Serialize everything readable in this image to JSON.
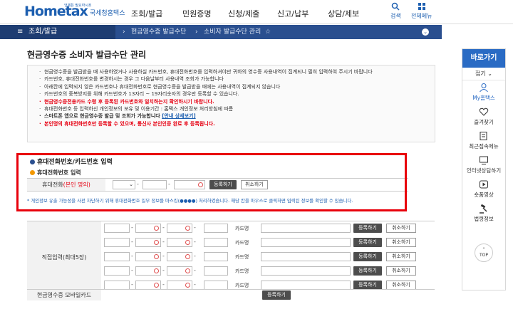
{
  "header": {
    "logo_main": "Hometax",
    "logo_sub": "국세청홈택스",
    "logo_top": "언제든 필요하시죠",
    "menu": [
      "조회/발급",
      "민원증명",
      "신청/제출",
      "신고/납부",
      "상담/제보"
    ],
    "search_label": "검색",
    "all_menu_label": "전체메뉴"
  },
  "navbar": {
    "menu_label": "조회/발급",
    "crumb1": "현금영수증 발급수단",
    "crumb2": "소비자 발급수단 관리"
  },
  "page_title": "현금영수증 소비자 발급수단 관리",
  "info": {
    "lines": [
      "현금영수증을 발급받을 때 사용하였거나 사용하실 카드번호, 휴대전화번호를 입력하셔야만 귀하의 영수증 사용내역이 집계되니 필히 입력하여 주시기 바랍니다",
      "카드번호, 휴대전화번호를 변경하시는 경우 그 다음날부터 사용내역 조회가 가능합니다",
      "아래칸에 입력되지 않은 카드번호나 휴대전화번호로 현금영수증을 발급받을 때에는 사용내역이 집계되지 않습니다",
      "카드번호의 중복방지를 위해 카드번호가 13자리 ~ 19자리숫자의 경우만 등록할 수 있습니다.",
      "현금영수증전용카드 수령 후 등록된 카드번호와 일치하는지 확인하시기 바랍니다.",
      "휴대전화번호 등 입력하신 개인정보의 보유 및 이용기간 : 홈택스 개인정보 처리방침에 따름",
      "스마트폰 앱으로 현금영수증 발급 및 조회가 가능합니다",
      "본인명의 휴대전화번호만 등록할 수 있으며, 통신사 본인인증 완료 후 등록됩니다."
    ],
    "link": "[안내 상세보기]"
  },
  "phone_section": {
    "title": "휴대전화번호/카드번호 입력",
    "sub_title": "휴대전화번호 입력",
    "label": "휴대전화",
    "label_red": "(본인 명의)",
    "register_btn": "등록하기",
    "cancel_btn": "취소하기",
    "notice": "* 개인정보 유출 가능성을 사전 차단하기 위해 휴대전화번호 일부 정보를 마스킹(●●●●) 처리하였습니다. 해당 칸을 마우스로 클릭하면 입력된 정보를 확인할 수 있습니다."
  },
  "card_section": {
    "label": "직접입력(최대5장)",
    "card_name_label": "카드명",
    "register_btn": "등록하기",
    "cancel_btn": "취소하기",
    "rows": 5
  },
  "mobile_section": {
    "label": "현금영수증 모바일카드",
    "register_btn": "등록하기"
  },
  "side": {
    "title": "바로가기",
    "fold": "접기",
    "items": [
      "My홈택스",
      "즐겨찾기",
      "최근접속메뉴",
      "인터넷상담하기",
      "숏폼영상",
      "법령정보"
    ],
    "top": "TOP"
  },
  "colors": {
    "brand": "#1d5fb0",
    "nav": "#2a4f8f",
    "highlight": "#e8000b"
  }
}
